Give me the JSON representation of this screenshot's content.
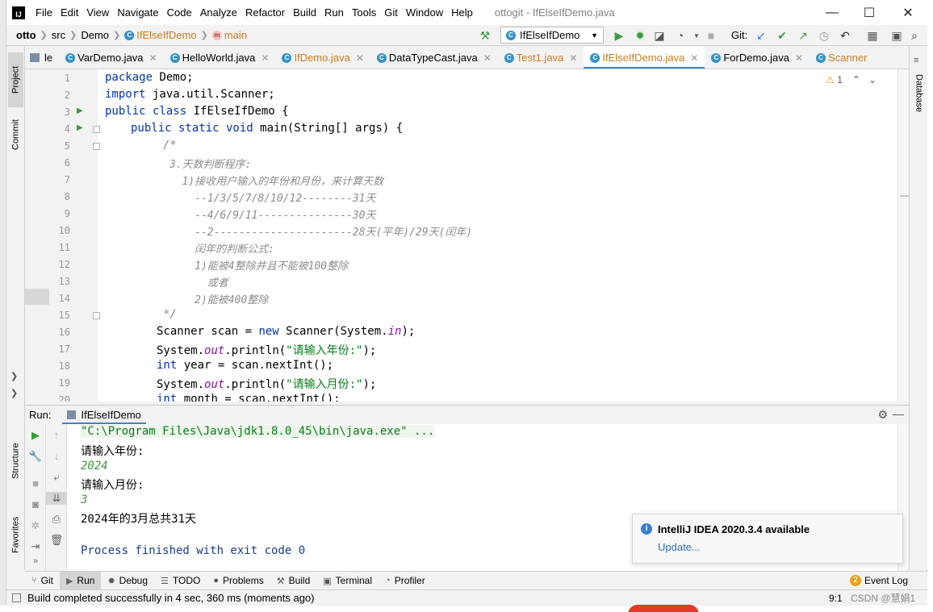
{
  "titlebar": {
    "menu": [
      "File",
      "Edit",
      "View",
      "Navigate",
      "Code",
      "Analyze",
      "Refactor",
      "Build",
      "Run",
      "Tools",
      "Git",
      "Window",
      "Help"
    ],
    "title": "ottogit - IfElseIfDemo.java"
  },
  "navbar": {
    "crumbs": [
      "otto",
      "src",
      "Demo",
      "IfElseIfDemo",
      "main"
    ],
    "run_config": "IfElseIfDemo",
    "git_label": "Git:"
  },
  "left_strip": {
    "project": "Project",
    "commit": "Commit",
    "structure": "Structure",
    "favorites": "Favorites"
  },
  "right_strip": {
    "database": "Database"
  },
  "tabs": [
    "le",
    "VarDemo.java",
    "HelloWorld.java",
    "IfDemo.java",
    "DataTypeCast.java",
    "Test1.java",
    "IfElseIfDemo.java",
    "ForDemo.java",
    "Scanner"
  ],
  "editor": {
    "warnings": "1",
    "line_numbers": [
      "1",
      "2",
      "3",
      "4",
      "5",
      "6",
      "7",
      "8",
      "9",
      "10",
      "11",
      "12",
      "13",
      "14",
      "15",
      "16",
      "17",
      "18",
      "19",
      "20"
    ],
    "code": {
      "l1_kw": "package",
      "l1_rest": " Demo;",
      "l2_kw": "import",
      "l2_rest": " java.util.Scanner;",
      "l3_kw": "public class",
      "l3_rest": " IfElseIfDemo {",
      "l4_kw": "public static void",
      "l4_rest": " main(String[] args) {",
      "l5": "/*",
      "l6": " 3.天数判断程序:",
      "l7": "   1)接收用户输入的年份和月份，来计算天数",
      "l8": "     --1/3/5/7/8/10/12--------31天",
      "l9": "     --4/6/9/11---------------30天",
      "l10": "     --2----------------------28天(平年)/29天(闰年)",
      "l11": "     闰年的判断公式:",
      "l12": "     1)能被4整除并且不能被100整除",
      "l13": "       或者",
      "l14": "     2)能被400整除",
      "l15": "*/",
      "l16_a": "Scanner scan = ",
      "l16_kw": "new",
      "l16_b": " Scanner(System.",
      "l16_f": "in",
      "l16_c": ");",
      "l17_a": "System.",
      "l17_f": "out",
      "l17_b": ".println(",
      "l17_s": "\"请输入年份:\"",
      "l17_c": ");",
      "l18_kw": "int",
      "l18_rest": " year = scan.nextInt();",
      "l19_a": "System.",
      "l19_f": "out",
      "l19_b": ".println(",
      "l19_s": "\"请输入月份:\"",
      "l19_c": ");",
      "l20_kw": "int",
      "l20_rest": " month = scan.nextInt();"
    }
  },
  "run_panel": {
    "label": "Run:",
    "tab": "IfElseIfDemo",
    "output": [
      "\"C:\\Program Files\\Java\\jdk1.8.0_45\\bin\\java.exe\" ...",
      "请输入年份:",
      "2024",
      "请输入月份:",
      "3",
      "2024年的3月总共31天",
      "",
      "Process finished with exit code 0"
    ]
  },
  "notification": {
    "title": "IntelliJ IDEA 2020.3.4 available",
    "link": "Update..."
  },
  "bottom_tools": [
    "Git",
    "Run",
    "Debug",
    "TODO",
    "Problems",
    "Build",
    "Terminal",
    "Profiler"
  ],
  "event_log": {
    "count": "2",
    "label": "Event Log"
  },
  "status": {
    "message": "Build completed successfully in 4 sec, 360 ms (moments ago)",
    "position": "9:1",
    "watermark": "CSDN @慧娟1"
  },
  "colors": {
    "accent": "#4083c9",
    "run_green": "#3a9c3a",
    "keyword": "#0033b3",
    "string": "#067d17"
  }
}
